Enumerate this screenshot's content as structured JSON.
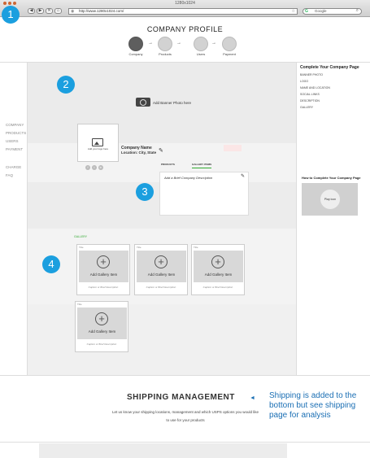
{
  "browser": {
    "window_title": "1280x1024",
    "nav_buttons": [
      "◀",
      "▶",
      "✕",
      "⌂"
    ],
    "url": "http://www.1280x1024.com/",
    "search_placeholder": "Google"
  },
  "badges": [
    "1",
    "2",
    "3",
    "4"
  ],
  "header": {
    "title": "COMPANY PROFILE",
    "steps": [
      {
        "label": "Company",
        "active": true
      },
      {
        "label": "Products",
        "active": false
      },
      {
        "label": "Users",
        "active": false
      },
      {
        "label": "Payment",
        "active": false
      }
    ],
    "arrow": "→"
  },
  "left_nav": {
    "items": [
      "COMPANY",
      "PRODUCTS",
      "USERS",
      "PAYMENT"
    ],
    "extra": [
      "CHARGE",
      "FAQ"
    ]
  },
  "banner": {
    "label": "Add Banner Photo here"
  },
  "logo": {
    "label": "Add your logo here"
  },
  "socials": [
    "f",
    "t",
    "in"
  ],
  "company": {
    "name": "Company Name",
    "location": "Location: City, State",
    "edit_icon": "✎"
  },
  "tabs": [
    "PRODUCTS",
    "GALLERY ITEMS"
  ],
  "description": {
    "placeholder": "Add a Brief Company Description",
    "edit_icon": "✎"
  },
  "gallery": {
    "label": "GALLERY",
    "items": [
      {
        "title": "Title",
        "add_label": "Add Gallery Item",
        "caption": "Caption or Brief Description"
      },
      {
        "title": "Title",
        "add_label": "Add Gallery Item",
        "caption": "Caption or Brief Description"
      },
      {
        "title": "Title",
        "add_label": "Add Gallery Item",
        "caption": "Caption or Brief Description"
      },
      {
        "title": "Title",
        "add_label": "Add Gallery Item",
        "caption": "Caption or Brief Description"
      }
    ]
  },
  "sidebar": {
    "title": "Complete Your Company Page",
    "items": [
      "BANNER PHOTO",
      "LOGO",
      "NAME AND LOCATION",
      "SOCIAL LINKS",
      "DESCRIPTION",
      "GALLERY"
    ],
    "howto_title": "How to Complete Your Company Page",
    "video_label": "Play icon"
  },
  "shipping": {
    "title": "SHIPPING MANAGEMENT",
    "arrow": "◄",
    "description_line1": "Let us know your shipping locations, management and which USPS options you would like",
    "description_line2": "to use for your products",
    "note": "Shipping is added to the bottom but see shipping page for analysis"
  }
}
